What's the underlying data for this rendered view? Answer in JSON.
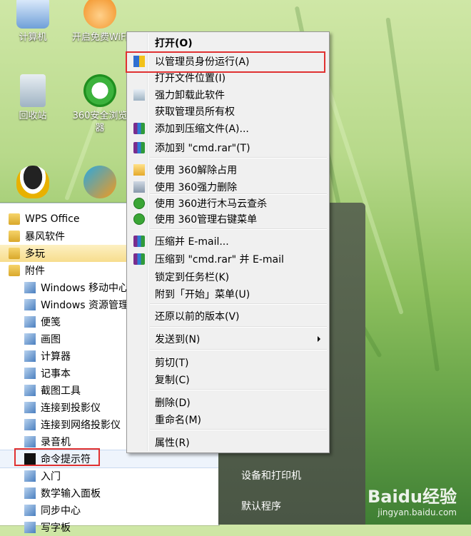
{
  "desktop": {
    "icons": [
      {
        "label": "计算机",
        "icon": "computer-icon"
      },
      {
        "label": "开启免费WiFi",
        "icon": "wifi-icon"
      },
      {
        "label": "回收站",
        "icon": "recycle-bin-icon"
      },
      {
        "label": "360安全浏览器",
        "icon": "browser-360-icon"
      },
      {
        "label": "",
        "icon": "qq-penguin-icon"
      },
      {
        "label": "",
        "icon": "app-icon"
      }
    ]
  },
  "start_menu": {
    "programs": [
      {
        "label": "WPS Office",
        "icon": "folder-icon"
      },
      {
        "label": "暴风软件",
        "icon": "folder-icon"
      },
      {
        "label": "多玩",
        "icon": "folder-icon"
      },
      {
        "label": "附件",
        "icon": "folder-icon"
      },
      {
        "label": "Windows 移动中心",
        "icon": "mobility-center-icon"
      },
      {
        "label": "Windows 资源管理器",
        "icon": "explorer-icon"
      },
      {
        "label": "便笺",
        "icon": "sticky-notes-icon"
      },
      {
        "label": "画图",
        "icon": "paint-icon"
      },
      {
        "label": "计算器",
        "icon": "calculator-icon"
      },
      {
        "label": "记事本",
        "icon": "notepad-icon"
      },
      {
        "label": "截图工具",
        "icon": "snipping-tool-icon"
      },
      {
        "label": "连接到投影仪",
        "icon": "projector-icon"
      },
      {
        "label": "连接到网络投影仪",
        "icon": "network-projector-icon"
      },
      {
        "label": "录音机",
        "icon": "microphone-icon"
      },
      {
        "label": "命令提示符",
        "icon": "cmd-icon"
      },
      {
        "label": "入门",
        "icon": "getting-started-icon"
      },
      {
        "label": "数学输入面板",
        "icon": "math-input-icon"
      },
      {
        "label": "同步中心",
        "icon": "sync-center-icon"
      },
      {
        "label": "写字板",
        "icon": "wordpad-icon"
      }
    ],
    "right": [
      {
        "label": "设备和打印机"
      },
      {
        "label": "默认程序"
      }
    ]
  },
  "context_menu": {
    "items": [
      {
        "label": "打开(O)",
        "bold": true,
        "icon": ""
      },
      {
        "label": "以管理员身份运行(A)",
        "icon": "uac-shield-icon"
      },
      {
        "label": "打开文件位置(I)",
        "icon": ""
      },
      {
        "label": "强力卸载此软件",
        "icon": "trash-icon"
      },
      {
        "label": "获取管理员所有权",
        "icon": ""
      },
      {
        "label": "添加到压缩文件(A)...",
        "icon": "winrar-icon"
      },
      {
        "label": "添加到 \"cmd.rar\"(T)",
        "icon": "winrar-icon"
      },
      {
        "label": "使用 360解除占用",
        "icon": "360-unlock-icon"
      },
      {
        "label": "使用 360强力删除",
        "icon": "360-shred-icon"
      },
      {
        "label": "使用 360进行木马云查杀",
        "icon": "360-scan-icon"
      },
      {
        "label": "使用 360管理右键菜单",
        "icon": "360-manage-icon"
      },
      {
        "label": "压缩并 E-mail...",
        "icon": "winrar-icon"
      },
      {
        "label": "压缩到 \"cmd.rar\" 并 E-mail",
        "icon": "winrar-icon"
      },
      {
        "label": "锁定到任务栏(K)",
        "icon": ""
      },
      {
        "label": "附到「开始」菜单(U)",
        "icon": ""
      },
      {
        "label": "还原以前的版本(V)",
        "icon": ""
      },
      {
        "label": "发送到(N)",
        "icon": "",
        "submenu": true
      },
      {
        "label": "剪切(T)",
        "icon": ""
      },
      {
        "label": "复制(C)",
        "icon": ""
      },
      {
        "label": "删除(D)",
        "icon": ""
      },
      {
        "label": "重命名(M)",
        "icon": ""
      },
      {
        "label": "属性(R)",
        "icon": ""
      }
    ]
  },
  "watermark": {
    "brand": "Baidu经验",
    "url": "jingyan.baidu.com"
  },
  "colors": {
    "highlight_red": "#e03131",
    "menu_bg": "#f0f0f0",
    "folder_highlight": "#f7dd8d"
  }
}
